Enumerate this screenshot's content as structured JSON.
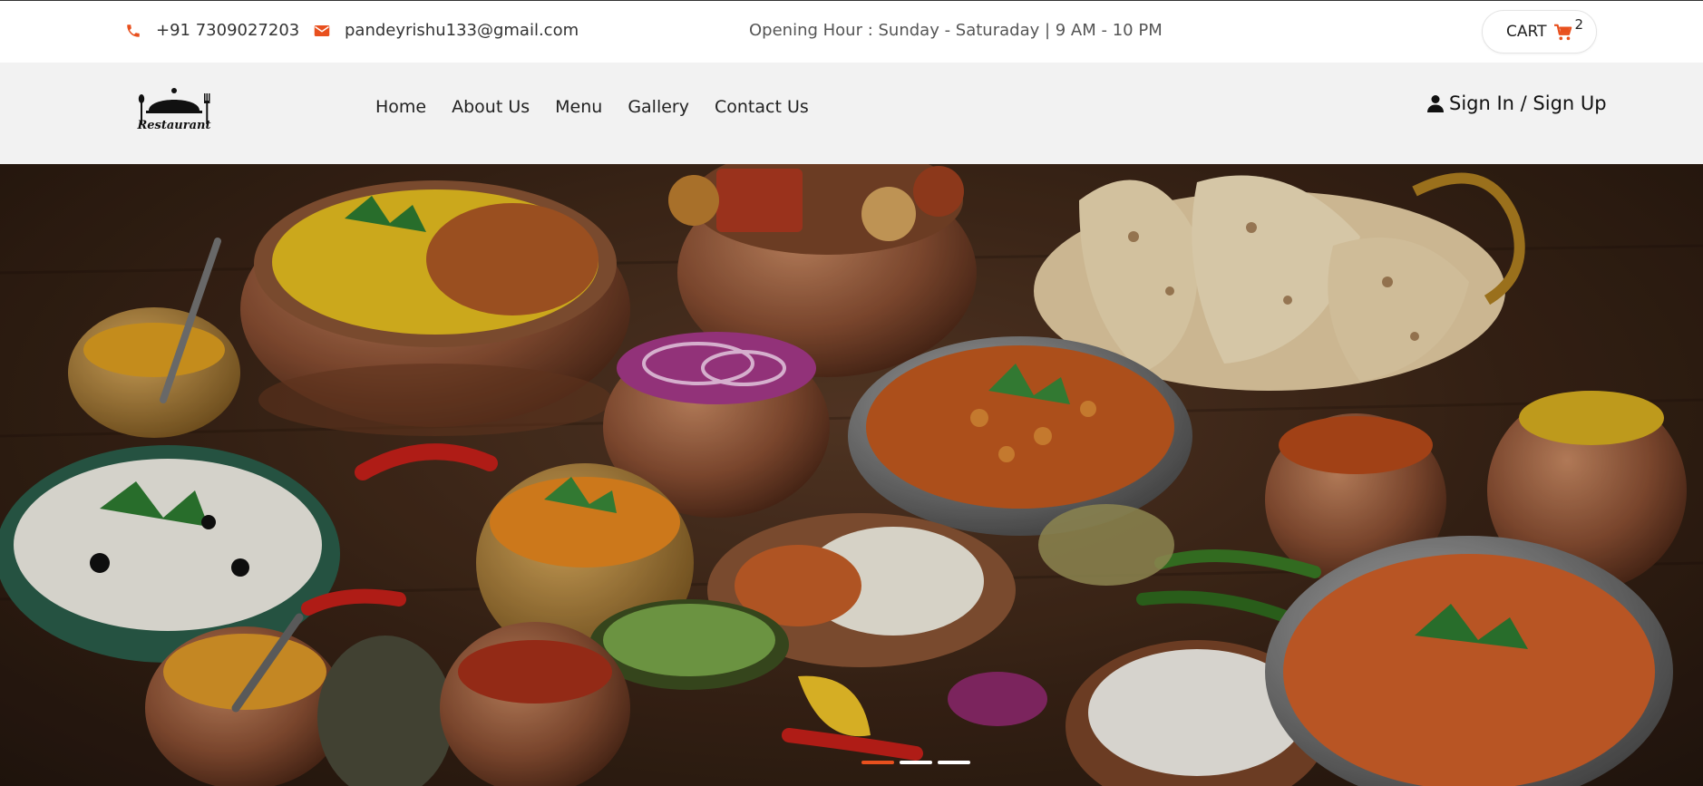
{
  "topbar": {
    "phone": "+91 7309027203",
    "email": "pandeyrishu133@gmail.com",
    "hours": "Opening Hour : Sunday - Saturaday | 9 AM - 10 PM",
    "cart_label": "CART",
    "cart_count": "2",
    "accent_color": "#e8501e"
  },
  "navbar": {
    "logo_text": "Restaurant",
    "links": [
      "Home",
      "About Us",
      "Menu",
      "Gallery",
      "Contact Us"
    ],
    "signin_label": "Sign In / Sign Up"
  },
  "hero": {
    "slides": 3,
    "active_slide": 1
  }
}
